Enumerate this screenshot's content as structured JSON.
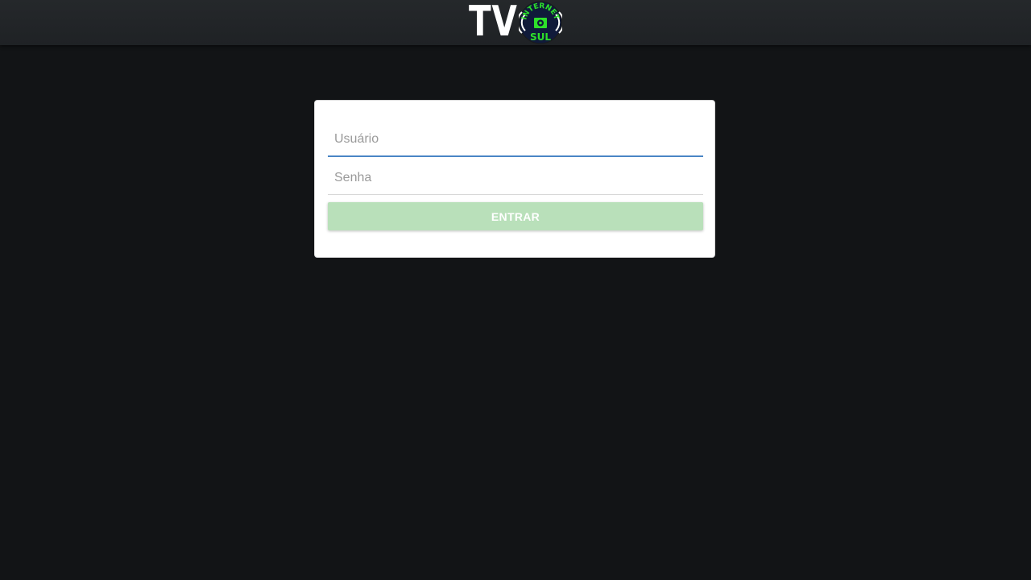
{
  "header": {
    "logo": {
      "text": "TV",
      "badge_top_text": "INTERNET",
      "badge_bottom_text": "SUL"
    }
  },
  "login": {
    "username_placeholder": "Usuário",
    "username_value": "",
    "password_placeholder": "Senha",
    "password_value": "",
    "submit_label": "ENTRAR"
  },
  "colors": {
    "background": "#121416",
    "header": "#222528",
    "card": "#ffffff",
    "focus_underline": "#4a86c5",
    "button": "#b9e0ba",
    "badge_green": "#2ee02a",
    "badge_dark": "#101a3a"
  }
}
